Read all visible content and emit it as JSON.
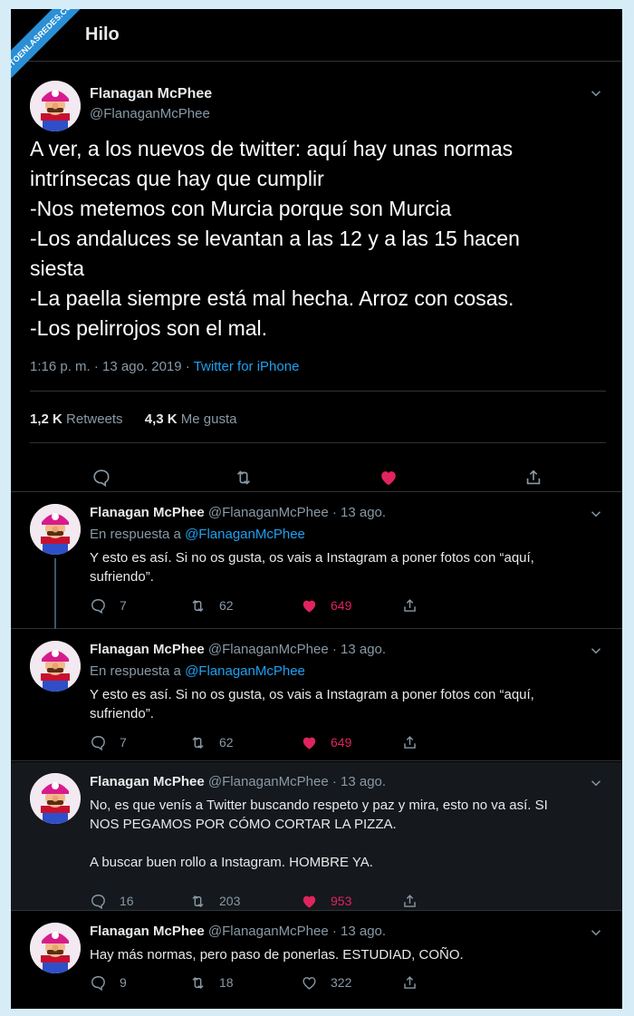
{
  "watermark": "VISTOENLASREDES.COM",
  "header": {
    "title": "Hilo"
  },
  "main_tweet": {
    "name": "Flanagan McPhee",
    "handle": "@FlanaganMcPhee",
    "lines": [
      "A ver, a los nuevos de twitter: aquí hay unas normas",
      "intrínsecas que hay que cumplir",
      "-Nos metemos con Murcia porque son Murcia",
      "-Los andaluces se levantan a las 12 y a las 15 hacen",
      "siesta",
      "-La paella siempre está mal hecha. Arroz con cosas.",
      "-Los pelirrojos son el mal."
    ],
    "time": "1:16 p. m. · 13 ago. 2019 · ",
    "source": "Twitter for iPhone",
    "retweets_count": "1,2 K",
    "retweets_label": "Retweets",
    "likes_count": "4,3 K",
    "likes_label": "Me gusta"
  },
  "replies": [
    {
      "name": "Flanagan McPhee",
      "handle": "@FlanaganMcPhee",
      "date": "· 13 ago.",
      "in_reply_prefix": "En respuesta a ",
      "in_reply_handle": "@FlanaganMcPhee",
      "lines": [
        "Y esto es así. Si no os gusta, os vais a Instagram a poner fotos con “aquí,",
        "sufriendo”."
      ],
      "replies": "7",
      "retweets": "62",
      "likes": "649",
      "liked": true
    },
    {
      "name": "Flanagan McPhee",
      "handle": "@FlanaganMcPhee",
      "date": "· 13 ago.",
      "in_reply_prefix": "En respuesta a ",
      "in_reply_handle": "@FlanaganMcPhee",
      "lines": [
        "Y esto es así. Si no os gusta, os vais a Instagram a poner fotos con “aquí,",
        "sufriendo”."
      ],
      "replies": "7",
      "retweets": "62",
      "likes": "649",
      "liked": true
    },
    {
      "name": "Flanagan McPhee",
      "handle": "@FlanaganMcPhee",
      "date": "· 13 ago.",
      "lines": [
        "No, es que venís a Twitter buscando respeto y paz y mira, esto no va así. SI",
        "NOS PEGAMOS POR CÓMO CORTAR LA PIZZA.",
        "",
        "A buscar buen rollo a Instagram. HOMBRE YA."
      ],
      "replies": "16",
      "retweets": "203",
      "likes": "953",
      "liked": true
    },
    {
      "name": "Flanagan McPhee",
      "handle": "@FlanaganMcPhee",
      "date": "· 13 ago.",
      "lines": [
        "Hay más normas, pero paso de ponerlas. ESTUDIAD, COÑO."
      ],
      "replies": "9",
      "retweets": "18",
      "likes": "322",
      "liked": false
    }
  ],
  "colors": {
    "background": "#000000",
    "text": "#e7e9ea",
    "muted": "#8899a6",
    "link": "#1da1f2",
    "like": "#e0245e",
    "divider": "#2f3336"
  }
}
